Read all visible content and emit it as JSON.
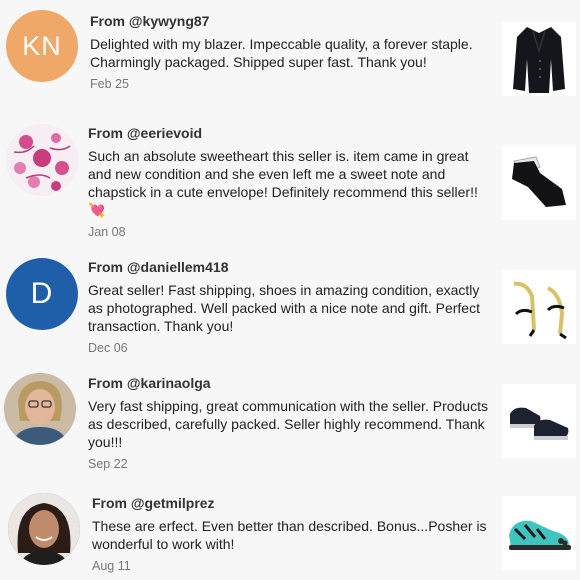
{
  "reviews": [
    {
      "from": "From @kywyng87",
      "initials": "KN",
      "text": "Delighted with my blazer. Impeccable quality, a forever staple. Charmingly packaged. Shipped super fast. Thank you!",
      "date": "Feb 25",
      "avatar_color": "#f0a868",
      "thumb": "black-blazer"
    },
    {
      "from": "From @eerievoid",
      "text": "Such an absolute sweetheart this seller is. item came in great and new condition and she even left me a sweet note and chapstick in a cute envelope! Definitely recommend this seller!! 💘",
      "date": "Jan 08",
      "thumb": "black-leggings"
    },
    {
      "from": "From @daniellem418",
      "initials": "D",
      "text": "Great seller! Fast shipping, shoes in amazing condition, exactly as photographed. Well packed with a nice note and gift. Perfect transaction. Thank you!",
      "date": "Dec 06",
      "avatar_color": "#1f5ea8",
      "thumb": "gold-sandals"
    },
    {
      "from": "From @karinaolga",
      "text": "Very fast shipping, great communication with the seller. Products as described, carefully packed. Seller highly recommend. Thank you!!!",
      "date": "Sep 22",
      "thumb": "black-sneakers"
    },
    {
      "from": "From @getmilprez",
      "text": "These are erfect. Even better than described. Bonus...Posher is wonderful to work with!",
      "date": "Aug 11",
      "thumb": "teal-toe-shoes"
    }
  ]
}
